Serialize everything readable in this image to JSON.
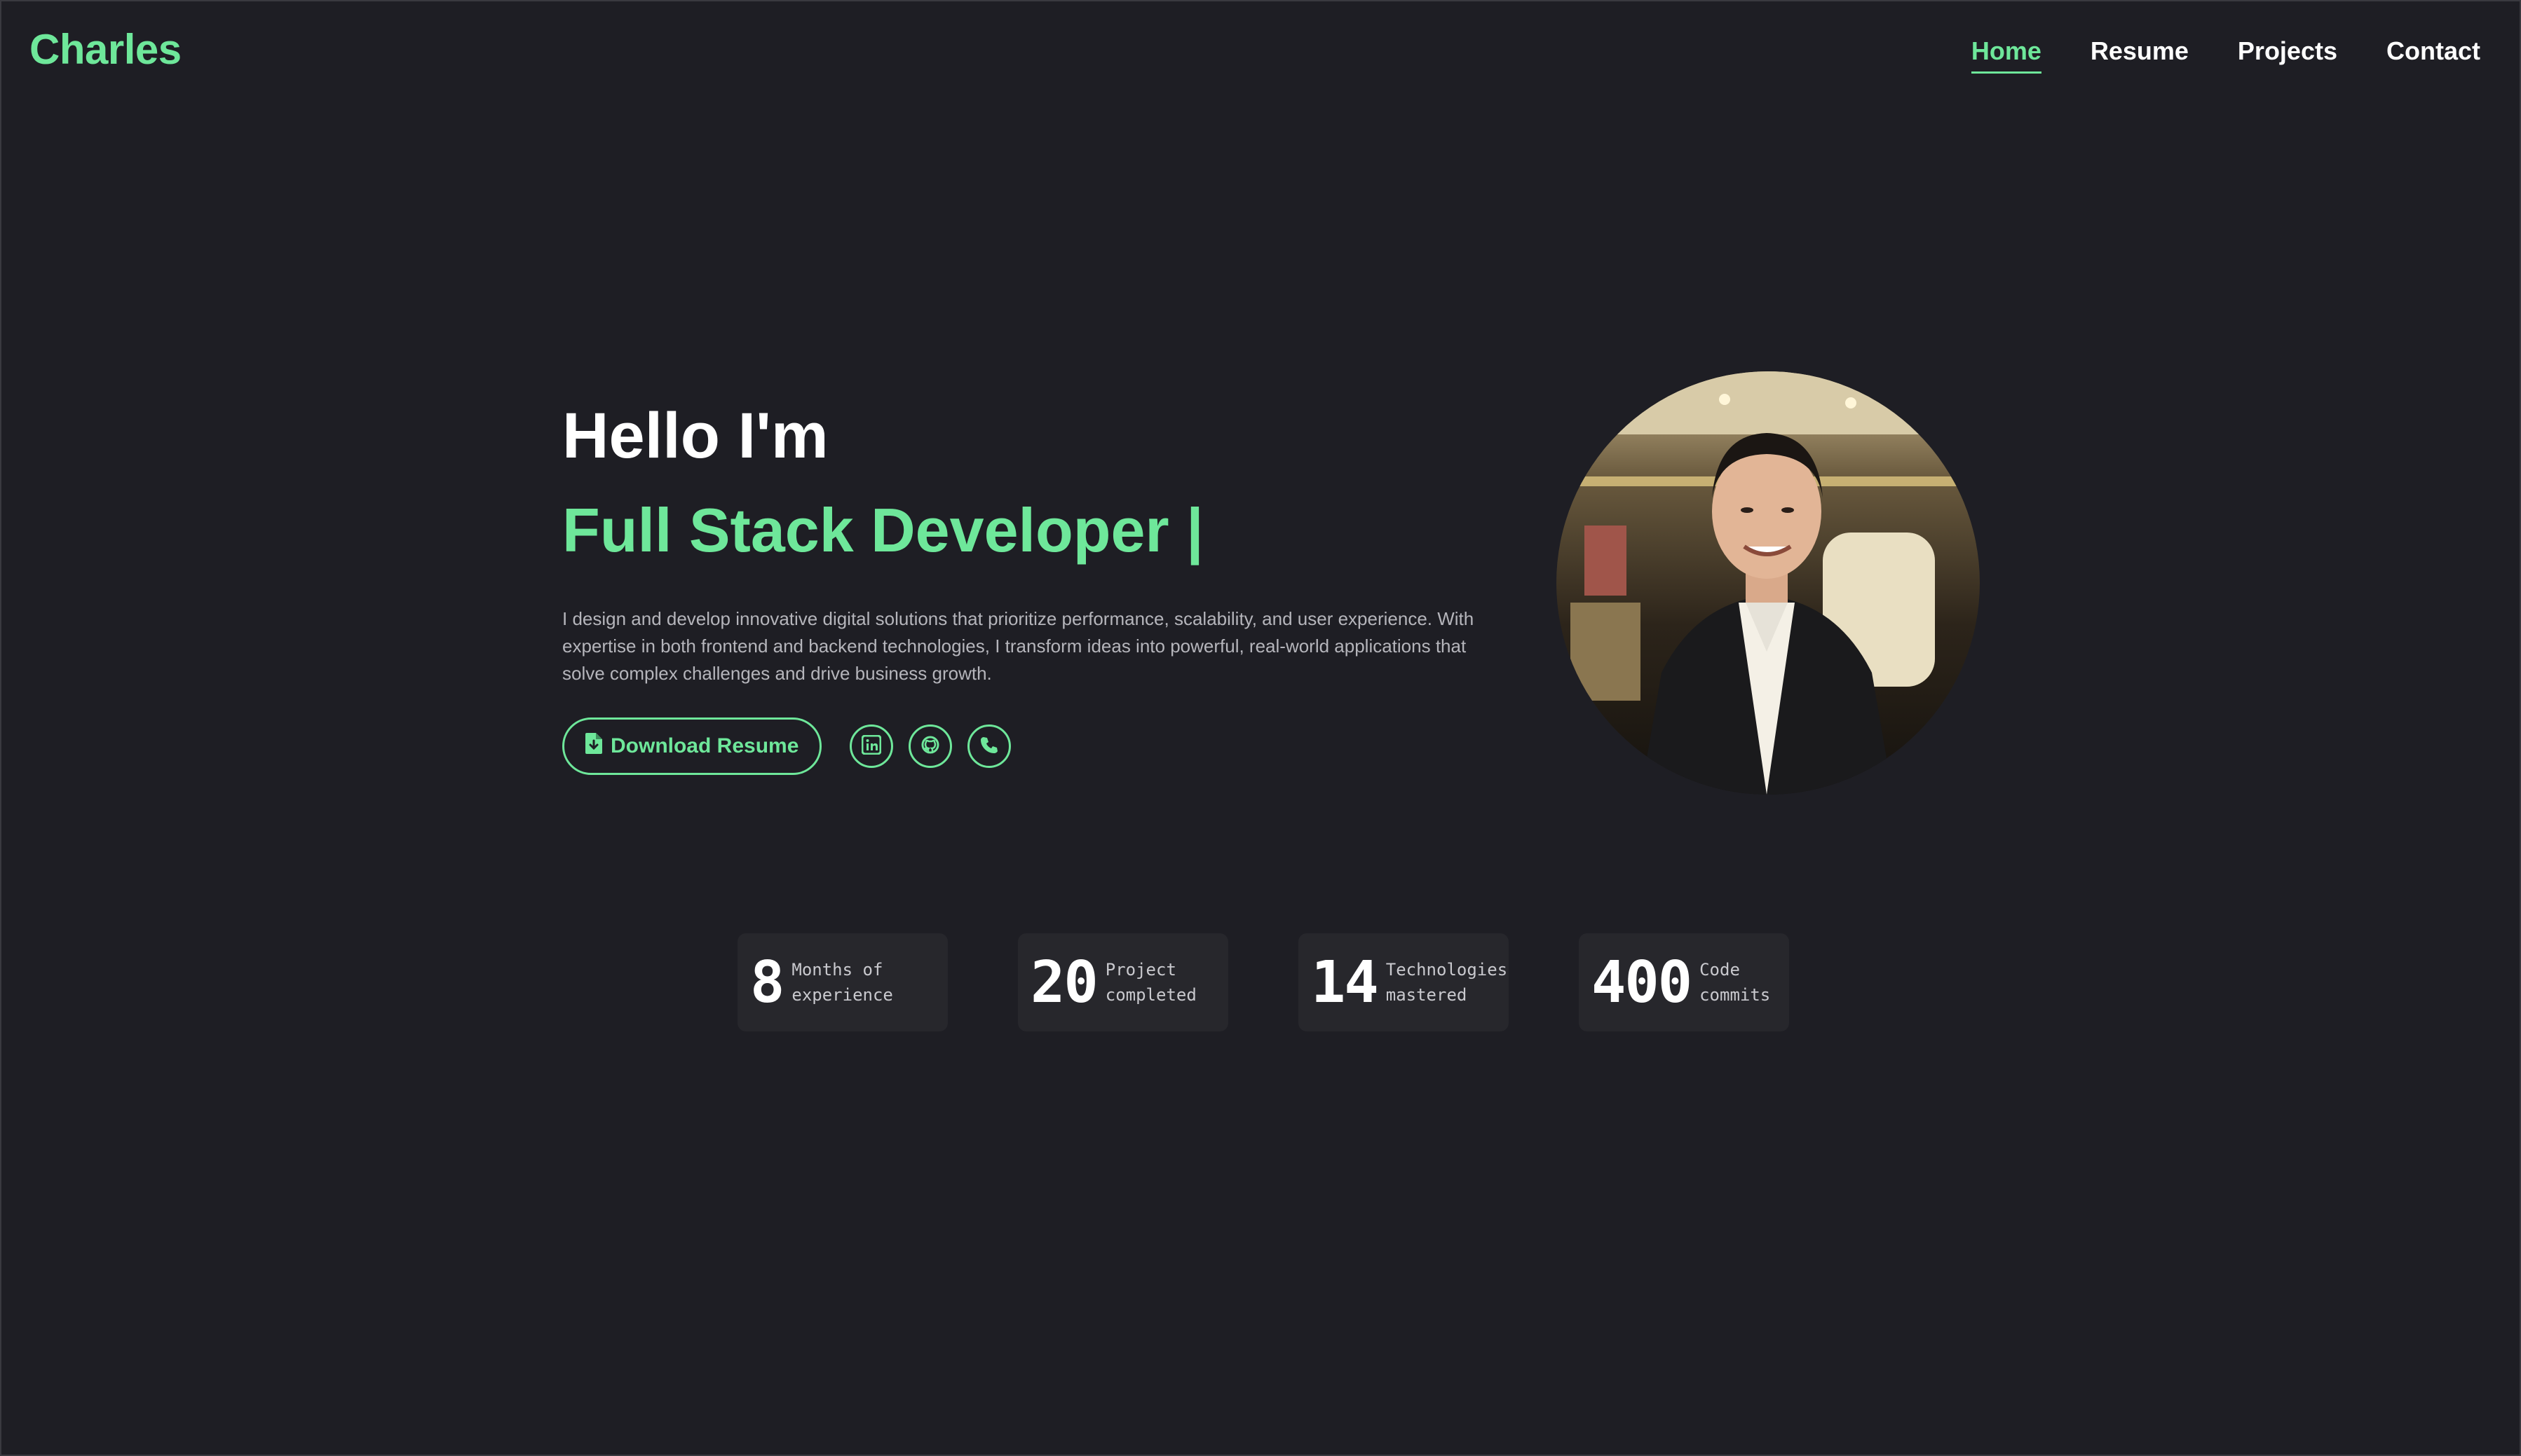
{
  "header": {
    "logo": "Charles",
    "nav": [
      {
        "label": "Home",
        "active": true
      },
      {
        "label": "Resume",
        "active": false
      },
      {
        "label": "Projects",
        "active": false
      },
      {
        "label": "Contact",
        "active": false
      }
    ]
  },
  "hero": {
    "greeting": "Hello I'm",
    "role": "Full Stack Developer |",
    "description": "I design and develop innovative digital solutions that prioritize performance, scalability, and user experience. With expertise in both frontend and backend technologies, I transform ideas into powerful, real-world applications that solve complex challenges and drive business growth.",
    "download_label": "Download Resume",
    "socials": [
      {
        "icon": "linkedin-icon"
      },
      {
        "icon": "github-icon"
      },
      {
        "icon": "phone-icon"
      }
    ]
  },
  "stats": [
    {
      "number": "8",
      "label": "Months of experience"
    },
    {
      "number": "20",
      "label": "Project completed"
    },
    {
      "number": "14",
      "label": "Technologies mastered"
    },
    {
      "number": "400",
      "label": "Code commits"
    }
  ],
  "colors": {
    "background": "#1e1e24",
    "accent": "#6ee79a",
    "card": "#27272c",
    "body_text": "#b5b5bb"
  }
}
